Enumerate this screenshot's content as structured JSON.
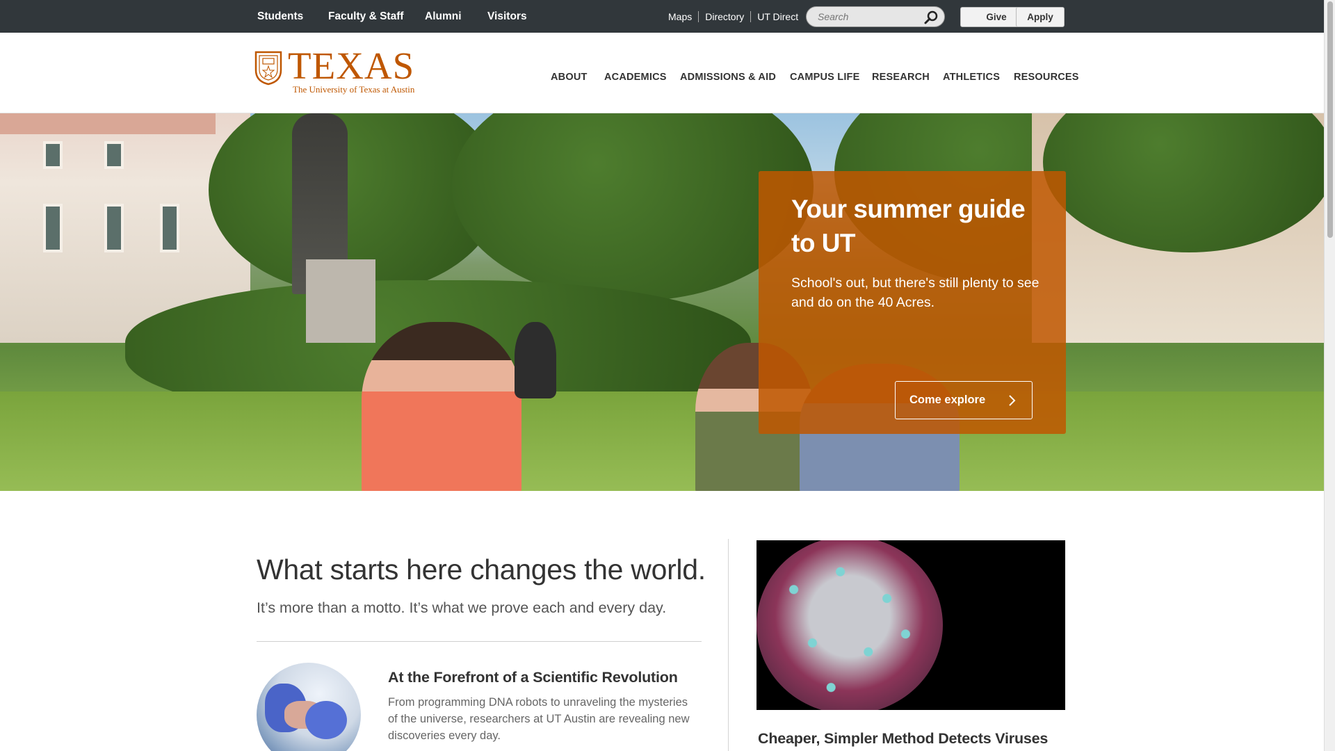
{
  "topbar": {
    "audiences": [
      "Students",
      "Faculty & Staff",
      "Alumni",
      "Visitors"
    ],
    "utility_links": [
      "Maps",
      "Directory",
      "UT Direct"
    ],
    "search_placeholder": "Search",
    "give_label": "Give",
    "apply_label": "Apply"
  },
  "header": {
    "logo_word": "TEXAS",
    "logo_sub": "The University of Texas at Austin",
    "nav": [
      "ABOUT",
      "ACADEMICS",
      "ADMISSIONS & AID",
      "CAMPUS LIFE",
      "RESEARCH",
      "ATHLETICS",
      "RESOURCES"
    ]
  },
  "hero": {
    "title": "Your summer guide to UT",
    "text": "School's out, but there's still plenty to see and do on the 40 Acres.",
    "cta": "Come explore"
  },
  "main": {
    "motto": "What starts here changes the world.",
    "motto_sub": "It’s more than a motto. It’s what we prove each and every day.",
    "article": {
      "title": "At the Forefront of a Scientific Revolution",
      "text": "From programming DNA robots to unraveling the mysteries of the universe, researchers at UT Austin are revealing new discoveries every day."
    },
    "feature_title": "Cheaper, Simpler Method Detects Viruses"
  },
  "colors": {
    "burnt_orange": "#bf5700",
    "topbar_bg": "#31373b"
  },
  "icons": {
    "search": "search-icon",
    "chevron": "chevron-right-icon",
    "seal": "seal-icon"
  }
}
